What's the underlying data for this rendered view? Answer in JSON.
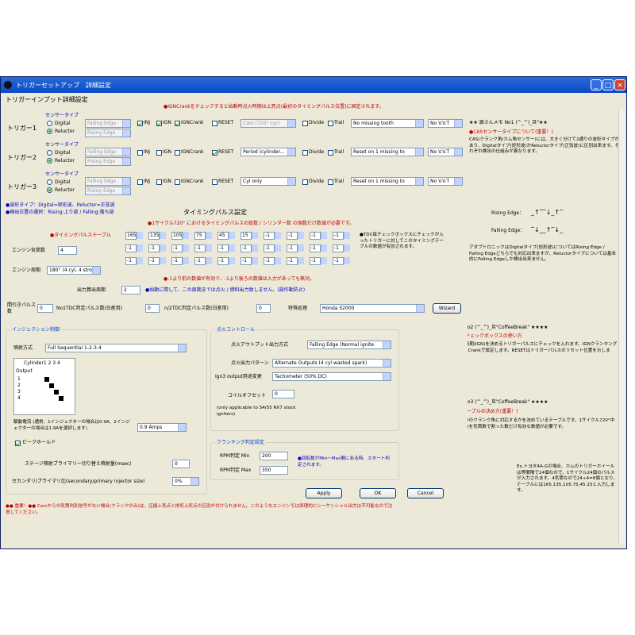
{
  "window": {
    "title": "トリガーセットアップ　詳細設定"
  },
  "colors": {
    "title_bar": "#0a4ac8",
    "window_bg": "#ece9d8",
    "warn_text": "#c00000",
    "info_text": "#0000c0",
    "check_green": "#21a121"
  },
  "trigger_input": {
    "title": "トリガーインプット詳細設定",
    "header_note": "●IGNCrankをチェックすると始動時点火時期は上死点(最初のタイミングパルス位置)に固定されます。",
    "sensor_type_label": "センサータイプ",
    "digital_label": "Digital",
    "reluctor_label": "Reluctor",
    "rows": [
      {
        "label": "トリガー1",
        "edge": "Falling Edge",
        "edge2": "Rising Edge",
        "mode": "Cam (720° cyc)",
        "missing": "No missing tooth",
        "vvt": "No V.V.T"
      },
      {
        "label": "トリガー2",
        "edge": "Falling Edge",
        "edge2": "Rising Edge",
        "mode": "Period (cylinder...",
        "missing": "Reset on 1 missing to",
        "vvt": "No V.V.T"
      },
      {
        "label": "トリガー3",
        "edge": "Falling Edge",
        "edge2": "Rising Edge",
        "mode": "Cyl only",
        "missing": "Reset on 1 missing to",
        "vvt": "No V.V.T"
      }
    ],
    "inj": "INJ",
    "ign": "IGN",
    "igncrank": "IGNCrank",
    "reset": "RESET",
    "divide": "Divide",
    "trail": "Trail",
    "notes": [
      "●波形タイプ：Digital=矩形波、Reluctor=正弦波",
      "●検出位置の選択：Rising:上り部 / Falling:落ち部"
    ]
  },
  "timing_pulse": {
    "title": "タイミングパルス設定",
    "note1": "●1サイクル720° におけるタイミングパルスの総数 / シリンダー数 の個数だけ数値が必要です。",
    "table_label": "●タイミングパルステーブル",
    "cylinders_label": "エンジン気筒数",
    "cylinders": "4",
    "cycle_label": "エンジン周期",
    "cycle": "180° (4 cyl, 4 stro",
    "rows": [
      [
        "165",
        "135",
        "105",
        "75",
        "45",
        "15",
        "-1",
        "-1",
        "-1",
        "-1"
      ],
      [
        "-1",
        "-1",
        "-1",
        "-1",
        "-1",
        "-1",
        "-1",
        "-1",
        "-1",
        "-1"
      ],
      [
        "-1",
        "-1",
        "-1",
        "-1",
        "-1",
        "-1",
        "-1",
        "-1",
        "-1",
        "-1"
      ]
    ],
    "side_note": "●TDC毎チェックボックスにチェックが入ったトリガーに対してこのタイミングテーブルの数値が有効されます。",
    "minus_note": "●-1より前の数値が有効で、-1より後ろの数値は入力があっても無効。",
    "output_period_label": "出力算出周期",
    "output_period": "2",
    "output_note": "●始動に際して、この周期までは点火 / 燃料出力致しません。(誤作動防止)",
    "cam_pulse_label": "間引きパルス数",
    "cam_pulse": "0",
    "n1_label": "No1TDC判定パルス数(日産用)",
    "n1": "0",
    "n2_label": "n/2TDC判定パルス数(日産用)",
    "n2": "0",
    "special_label": "特殊処理",
    "special": "Honda S2000",
    "wizard": "Wizard"
  },
  "injection": {
    "title": "インジェクション制御",
    "mode_label": "噴射方式",
    "mode": "Full Sequential      1-2-3-4",
    "cylinder_header": "Cylinder1  2  3  4",
    "output_label": "Output",
    "drive_label": "駆動電流 (通常、1インジェクターの場合は0.9A、2インジェクターの場合は1.9Aを選択します)",
    "drive": "0.9 Amps",
    "peak_hold": "ピークホールド",
    "stage_label": "ステージ噴射プライマリー切り替え噴射量(msec)",
    "stage": "0",
    "ratio_label": "セカンダリ/プライマリ比(secondary/primary injector size)",
    "ratio": "0%"
  },
  "ignition": {
    "title": "点火コントロール",
    "output_label": "点火アウトプット出力方式",
    "output": "Falling Edge (Normal ignite",
    "pattern_label": "点火出力パターン",
    "pattern": "Alternate Outputs (4 cyl wasted spark)",
    "ign3_label": "Ign3 output用途変更",
    "ign3": "Tachometer (50% DC)",
    "coil_label": "コイルオフセット",
    "coil": "0",
    "coil_note": "(only applicable to S4/S5 RX7 stock igniters)"
  },
  "cranking": {
    "title": "クランキング判定設定",
    "min_label": "RPM判定 Min",
    "min": "200",
    "max_label": "RPM判定 Max",
    "max": "350",
    "note": "●回転数がMin〜Max間にある時、スタート判定されます。"
  },
  "buttons": {
    "apply": "Apply",
    "ok": "OK",
    "cancel": "Cancel"
  },
  "bottom_warning": "●● 重要！●● Camからの気筒判別信号がない場合(クランクのみ)は、圧縮上死点と排気上死点の区別が付けられません。このようなエンジンでは原理的にシーケンシャル出力は不可能なので注意してください。",
  "side_panel": {
    "memo1_title": "★★ 源さんメモ No1 (^_^)_旦\"★★",
    "memo1_head": "●CASセンサータイプについて(重要！)",
    "memo1_body": "CAS(クランク角/カム角センサー)には、大きく分けて2通りの波形タイプがあり、Digitalタイプ(矩形波)かReluctorタイプ(正弦波)に区別出来ます。それぞれ検出の仕組みが異なります。",
    "rising_label": "Rising Edge：",
    "falling_label": "Falling Edge：",
    "memo1_body2": "アダプトロニックはDigitalタイプ(矩形波)についてはRising Edge / Falling Edgeどちらでも対応出来ますが、Reluctorタイプについては基本的にFalling Edgeしか検出出来ません。",
    "memo2_title": "★★★★ 源さんメモ No2 (^_^)_旦\"CoffeeBreak\" ★★★★",
    "memo2_head": "●INJ / IGN / RESET チェックボックスの使い方",
    "memo2_body": "燃料噴射(INJ)及び点火時期(IGN)を決めるトリガーパルスにチェックを入れます。IGNクランキング時の固定点火時期をIGNCrankで設定します。RESETはトリガーパルスのリセット位置を示します。",
    "memo3_title": "★★★★ 源さんメモ No3 (^_^)_旦\"CoffeeBreak\" ★★★★",
    "memo3_head": "●タイミングパルステーブルの決め方(重要！)",
    "memo3_body": "タイミングパルスがいつのクランク角に対応するかを決めているテーブルです。1サイクル720°中に入力されるパルス総数を気筒数で割った数だけ有効な数値が必要です。",
    "memo3_body2": "Ex.トヨタ4A-Gの場合、カムのトリガーホイールは等間隔で24個なので、1サイクル24個のパルスが入力されます。4気筒なので24÷4=6個となり、テーブルには165,135,105,75,45,15と入力します。"
  }
}
